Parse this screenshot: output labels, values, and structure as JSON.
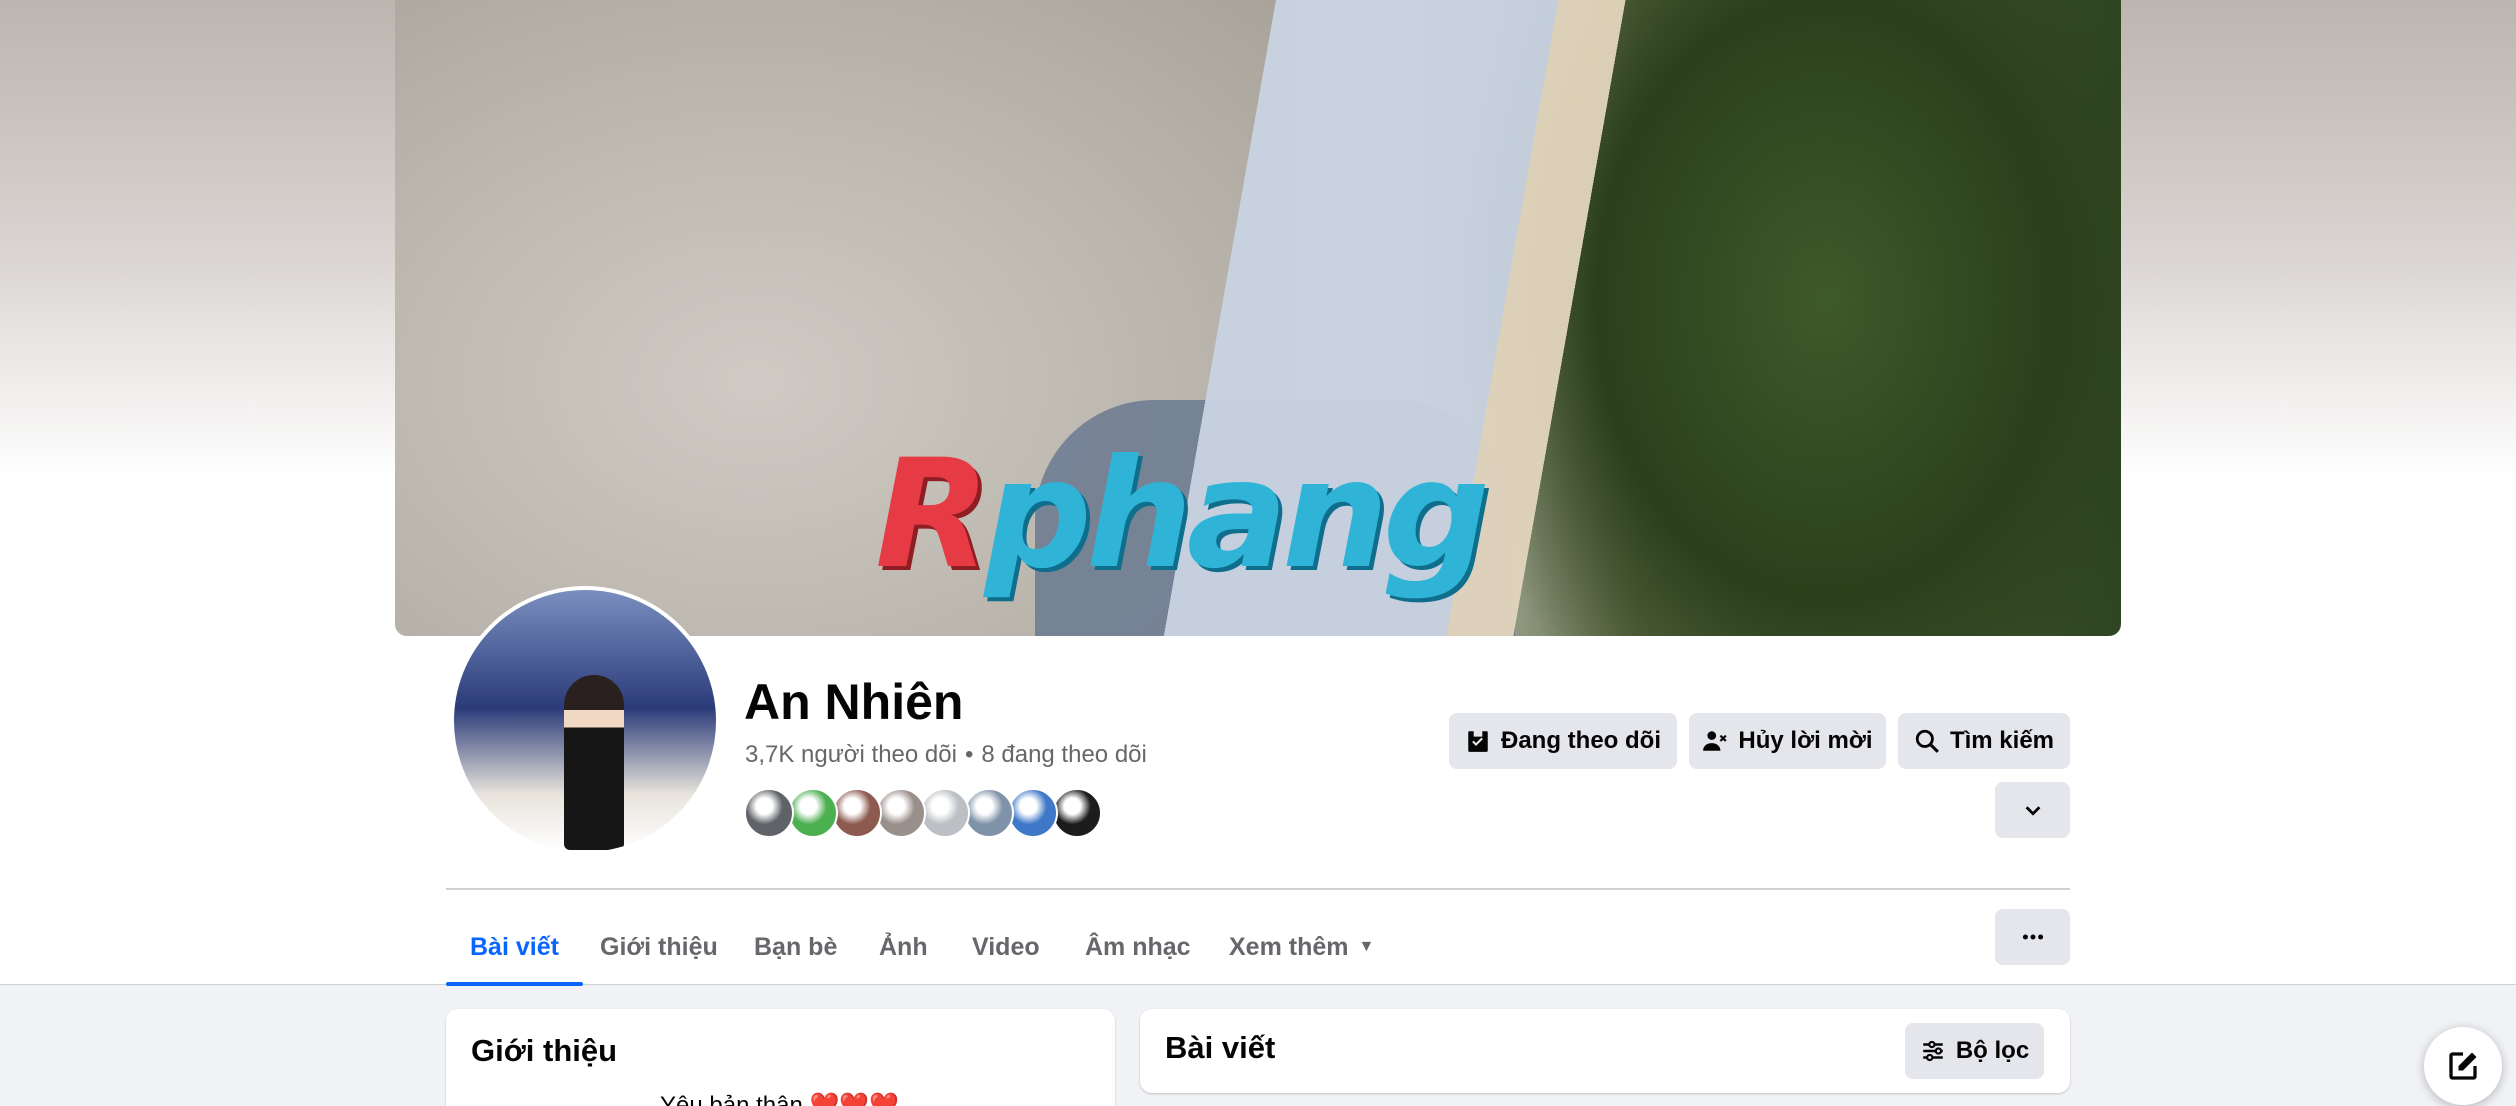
{
  "profile": {
    "name": "An Nhiên",
    "followers": "3,7K người theo dõi",
    "separator": "•",
    "following": "8 đang theo dõi",
    "friend_avatars": [
      "#5f6368",
      "#4caf50",
      "#8d5a4f",
      "#9a8f8a",
      "#bcc0c4",
      "#7f93a8",
      "#3f78c8",
      "#1c1c1c"
    ]
  },
  "cover": {
    "watermark_first": "R",
    "watermark_rest": "phang"
  },
  "actions": {
    "following_label": "Đang theo dõi",
    "cancel_request_label": "Hủy lời mời",
    "search_label": "Tìm kiếm"
  },
  "tabs": [
    {
      "label": "Bài viết",
      "active": true
    },
    {
      "label": "Giới thiệu"
    },
    {
      "label": "Bạn bè"
    },
    {
      "label": "Ảnh"
    },
    {
      "label": "Video"
    },
    {
      "label": "Âm nhạc"
    },
    {
      "label": "Xem thêm"
    }
  ],
  "intro": {
    "title": "Giới thiệu",
    "bio": "Yêu bản thân ❤️❤️❤️"
  },
  "posts": {
    "title": "Bài viết",
    "filter_label": "Bộ lọc"
  },
  "colors": {
    "accent": "#0866ff",
    "button_bg": "#e4e6eb",
    "secondary_text": "#65676b"
  },
  "icons": {
    "following": "bookmark-check-icon",
    "cancel_request": "user-x-icon",
    "search": "search-icon",
    "more_dropdown": "chevron-down-icon",
    "tab_more": "caret-down-icon",
    "tab_options": "more-horizontal-icon",
    "filter": "sliders-icon",
    "compose": "compose-icon"
  }
}
